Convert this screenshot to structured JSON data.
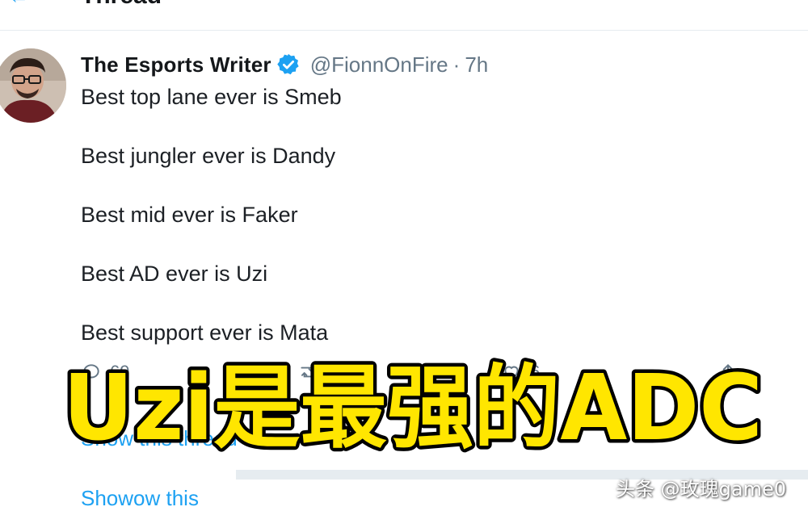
{
  "header": {
    "title": "Thread"
  },
  "tweet": {
    "author_name": "The Esports Writer",
    "handle": "@FionnOnFire",
    "separator": "·",
    "time": "7h",
    "lines": [
      "Best top lane ever is Smeb",
      "Best jungler ever is Dandy",
      "Best mid ever is Faker",
      "Best AD ever is Uzi",
      "Best support ever is Mata"
    ],
    "reply_count": "69",
    "like_count": "6",
    "show_thread_label": "Show this thread"
  },
  "more": {
    "label": "Showow this"
  },
  "overlay": {
    "caption": "Uzi是最强的ADC"
  },
  "watermark": {
    "text": "头条 @玫瑰game0"
  },
  "colors": {
    "link_blue": "#1da1f2",
    "muted_gray": "#657786",
    "caption_yellow": "#ffe600"
  },
  "icons": {
    "back": "back-arrow-icon",
    "verified": "verified-badge-icon",
    "reply": "reply-icon",
    "retweet": "retweet-icon",
    "like": "like-icon",
    "share": "share-icon"
  }
}
